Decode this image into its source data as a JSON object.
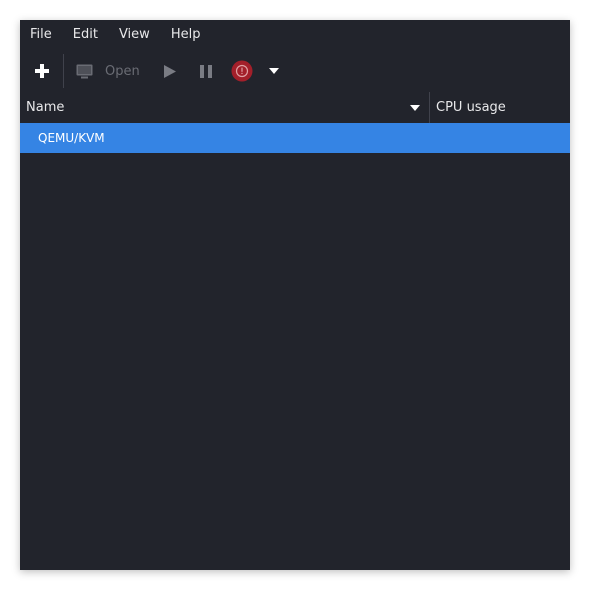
{
  "menubar": {
    "items": [
      {
        "label": "File"
      },
      {
        "label": "Edit"
      },
      {
        "label": "View"
      },
      {
        "label": "Help"
      }
    ]
  },
  "toolbar": {
    "new_icon": "plus-icon",
    "open_icon": "monitor-icon",
    "open_label": "Open",
    "run_icon": "play-icon",
    "pause_icon": "pause-icon",
    "shutdown_icon": "power-icon",
    "shutdown_menu_icon": "chevron-down-icon",
    "disabled_color": "#6a6c74",
    "shutdown_color": "#a31f2a"
  },
  "list_header": {
    "columns": [
      {
        "label": "Name"
      },
      {
        "label": "CPU usage"
      }
    ]
  },
  "connections": [
    {
      "label": "QEMU/KVM",
      "selected": true
    }
  ],
  "colors": {
    "window_bg": "#22242c",
    "selection": "#3584e4",
    "text": "#e8e8ea"
  }
}
